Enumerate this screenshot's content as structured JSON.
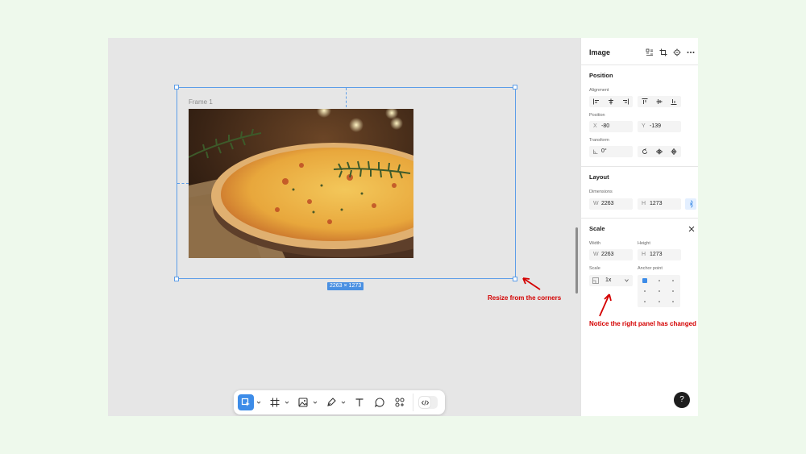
{
  "canvas": {
    "frame_label": "Frame 1",
    "dimension_badge": "2263 × 1273",
    "annotation_resize": "Resize from the corners",
    "annotation_panel": "Notice the right panel has changed",
    "annotation_color": "#d40000",
    "selection_color": "#5c9de8"
  },
  "toolbar": {
    "tools": [
      "move-tool",
      "frame-tool",
      "image-tool",
      "pen-tool",
      "text-tool",
      "comment-tool",
      "components-tool",
      "dev-mode-toggle"
    ],
    "active_tool": "move-tool",
    "accent": "#3d8ce8"
  },
  "panel": {
    "title": "Image",
    "header_icons": [
      "grid-icon",
      "crop-icon",
      "component-icon",
      "more-icon"
    ],
    "position": {
      "title": "Position",
      "alignment_label": "Alignment",
      "position_label": "Position",
      "x_prefix": "X",
      "x_value": "-80",
      "y_prefix": "Y",
      "y_value": "-139",
      "transform_label": "Transform",
      "rotation_value": "0°"
    },
    "layout": {
      "title": "Layout",
      "dimensions_label": "Dimensions",
      "w_prefix": "W",
      "w_value": "2263",
      "h_prefix": "H",
      "h_value": "1273"
    },
    "scale": {
      "title": "Scale",
      "width_label": "Width",
      "height_label": "Height",
      "w_prefix": "W",
      "w_value": "2263",
      "h_prefix": "H",
      "h_value": "1273",
      "scale_label": "Scale",
      "scale_value": "1x",
      "anchor_label": "Anchor point"
    },
    "help_label": "?"
  }
}
